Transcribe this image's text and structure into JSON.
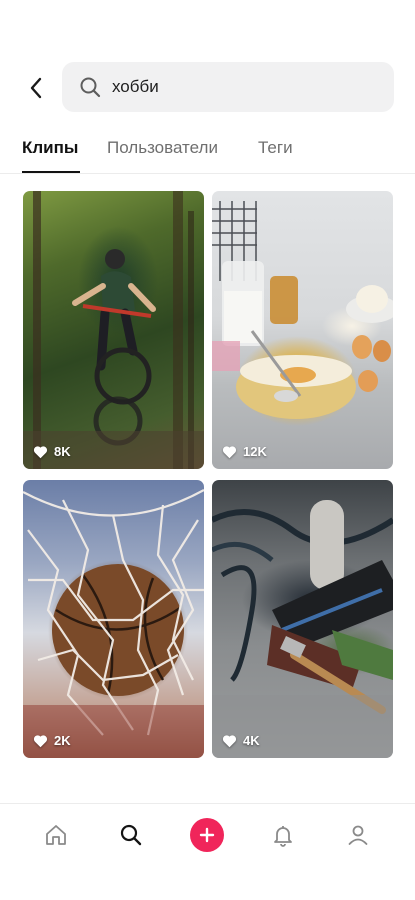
{
  "search": {
    "query": "хобби",
    "back_icon": "chevron-left-icon",
    "search_icon": "search-icon"
  },
  "tabs": [
    {
      "label": "Клипы",
      "active": true
    },
    {
      "label": "Пользователи",
      "active": false
    },
    {
      "label": "Теги",
      "active": false
    }
  ],
  "results": [
    {
      "likes": "8K",
      "subject": "mountain-biker"
    },
    {
      "likes": "12K",
      "subject": "baking-bowl"
    },
    {
      "likes": "2K",
      "subject": "basketball-hoop"
    },
    {
      "likes": "4K",
      "subject": "tool-belt"
    }
  ],
  "nav": [
    {
      "icon": "home-icon",
      "active": false
    },
    {
      "icon": "search-icon",
      "active": true
    },
    {
      "icon": "plus-icon",
      "active": false
    },
    {
      "icon": "bell-icon",
      "active": false
    },
    {
      "icon": "profile-icon",
      "active": false
    }
  ],
  "colors": {
    "accent": "#f0255a",
    "active_text": "#121212",
    "inactive_text": "#6f6f6f",
    "search_bg": "#f1f1f2"
  }
}
